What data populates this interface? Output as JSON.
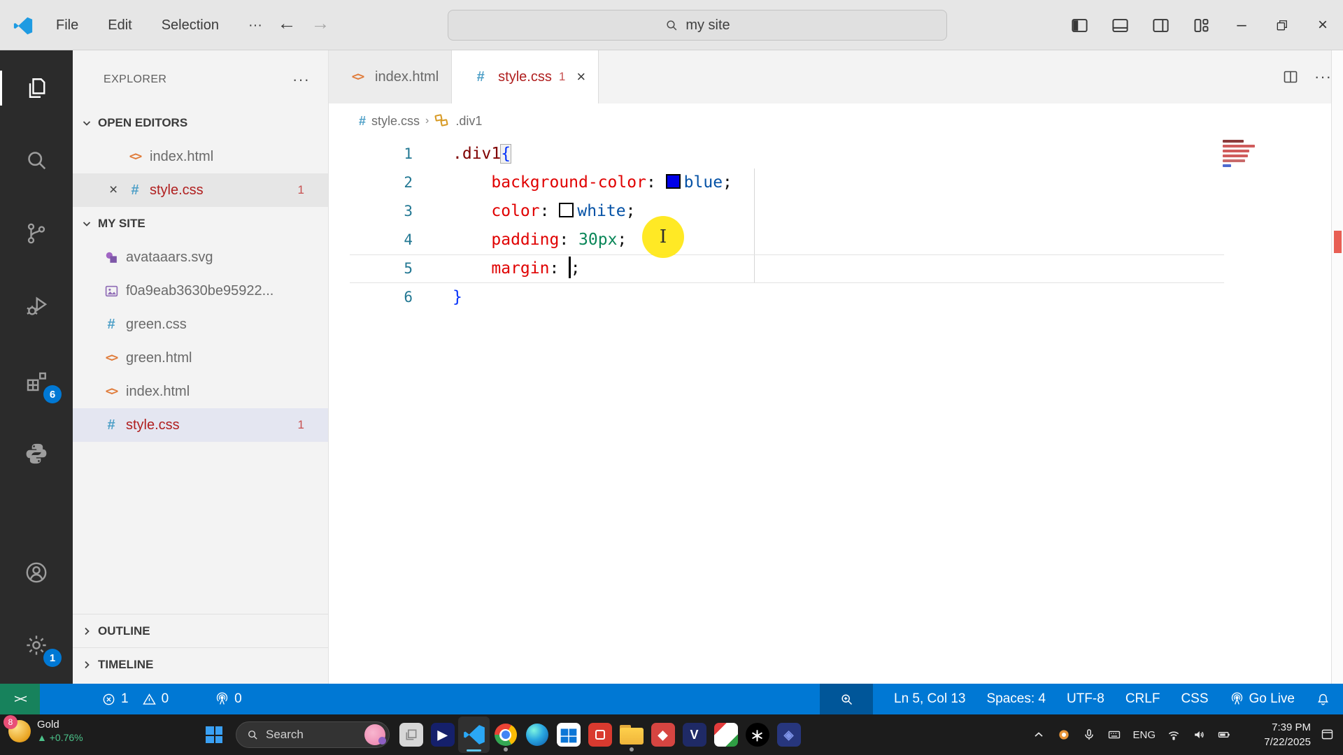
{
  "title_bar": {
    "menus": [
      "File",
      "Edit",
      "Selection",
      "···"
    ],
    "search_value": "my site"
  },
  "icons_glyphs": {
    "back_arrow": "←",
    "forward_arrow": "→",
    "minimize": "–",
    "close": "×",
    "more_dots": "···",
    "html_glyph": "<>",
    "css_glyph": "#",
    "remote_glyph": "><"
  },
  "activity_bar": {
    "items": [
      {
        "name": "explorer",
        "icon": "files",
        "active": true
      },
      {
        "name": "search",
        "icon": "search"
      },
      {
        "name": "source-control",
        "icon": "git"
      },
      {
        "name": "run-debug",
        "icon": "debug"
      },
      {
        "name": "extensions",
        "icon": "extensions",
        "badge": "6"
      },
      {
        "name": "python",
        "icon": "python"
      },
      {
        "name": "accounts",
        "icon": "account"
      },
      {
        "name": "settings",
        "icon": "gear",
        "badge": "1"
      }
    ]
  },
  "explorer": {
    "title": "EXPLORER",
    "actions_label": "···",
    "open_editors_label": "OPEN EDITORS",
    "open_editors": [
      {
        "label": "index.html",
        "icon": "html"
      },
      {
        "label": "style.css",
        "icon": "css",
        "badge": "1",
        "close": true,
        "selected": true,
        "error": true
      }
    ],
    "folder_label": "MY SITE",
    "files": [
      {
        "label": "avataaars.svg",
        "icon": "svg"
      },
      {
        "label": "f0a9eab3630be95922...",
        "icon": "image"
      },
      {
        "label": "green.css",
        "icon": "css"
      },
      {
        "label": "green.html",
        "icon": "html"
      },
      {
        "label": "index.html",
        "icon": "html"
      },
      {
        "label": "style.css",
        "icon": "css",
        "badge": "1",
        "selected": true,
        "error": true
      }
    ],
    "outline_label": "OUTLINE",
    "timeline_label": "TIMELINE"
  },
  "tabs": [
    {
      "label": "index.html",
      "icon": "html"
    },
    {
      "label": "style.css",
      "icon": "css",
      "badge": "1",
      "active": true,
      "error": true
    }
  ],
  "breadcrumb": {
    "file": "style.css",
    "separator": "›",
    "symbol": ".div1"
  },
  "code": {
    "lines": [
      {
        "num": "1",
        "tokens": [
          {
            "text": ".div1",
            "color": "sel"
          },
          {
            "text": "{",
            "color": "brace",
            "box": true
          }
        ]
      },
      {
        "num": "2",
        "tokens": [
          {
            "text": "    ",
            "color": "plain"
          },
          {
            "text": "background-color",
            "color": "prop"
          },
          {
            "text": ": ",
            "color": "plain"
          },
          {
            "swatch": "#0000e8"
          },
          {
            "text": "blue",
            "color": "val"
          },
          {
            "text": ";",
            "color": "plain"
          }
        ]
      },
      {
        "num": "3",
        "tokens": [
          {
            "text": "    ",
            "color": "plain"
          },
          {
            "text": "color",
            "color": "prop"
          },
          {
            "text": ": ",
            "color": "plain"
          },
          {
            "swatch": "#ffffff"
          },
          {
            "text": "white",
            "color": "val"
          },
          {
            "text": ";",
            "color": "plain"
          }
        ]
      },
      {
        "num": "4",
        "tokens": [
          {
            "text": "    ",
            "color": "plain"
          },
          {
            "text": "padding",
            "color": "prop"
          },
          {
            "text": ": ",
            "color": "plain"
          },
          {
            "text": "30px",
            "color": "num"
          },
          {
            "text": ";",
            "color": "plain"
          }
        ]
      },
      {
        "num": "5",
        "current": true,
        "tokens": [
          {
            "text": "    ",
            "color": "plain"
          },
          {
            "text": "margin",
            "color": "prop"
          },
          {
            "text": ": ",
            "color": "plain"
          },
          {
            "caret": true
          },
          {
            "text": ";",
            "color": "plain"
          }
        ]
      },
      {
        "num": "6",
        "tokens": [
          {
            "text": "}",
            "color": "brace"
          }
        ]
      }
    ]
  },
  "status_bar": {
    "remote_label": "><",
    "errors": "1",
    "warnings": "0",
    "ports": "0",
    "line_col": "Ln 5, Col 13",
    "indent": "Spaces: 4",
    "encoding": "UTF-8",
    "eol": "CRLF",
    "language": "CSS",
    "go_live": "Go Live"
  },
  "taskbar": {
    "widget_badge": "8",
    "widget_title": "Gold",
    "widget_change": "▲ +0.76%",
    "search_placeholder": "Search",
    "language": "ENG",
    "time": "7:39 PM",
    "date": "7/22/2025",
    "apps": [
      {
        "name": "photos-app",
        "kind": "photos"
      },
      {
        "name": "media-app",
        "kind": "media"
      },
      {
        "name": "vscode",
        "kind": "vscode",
        "active": true
      },
      {
        "name": "chrome",
        "kind": "chrome",
        "running": true
      },
      {
        "name": "edge",
        "kind": "edge"
      },
      {
        "name": "microsoft-store",
        "kind": "store"
      },
      {
        "name": "red-app",
        "kind": "red"
      },
      {
        "name": "file-explorer",
        "kind": "folder",
        "running": true
      },
      {
        "name": "diamond-app",
        "kind": "diamond"
      },
      {
        "name": "v-app",
        "kind": "v"
      },
      {
        "name": "canva-app",
        "kind": "canva"
      },
      {
        "name": "chatgpt",
        "kind": "chatgpt"
      },
      {
        "name": "blue-app",
        "kind": "blue"
      }
    ]
  },
  "colors": {
    "accent": "#0078d4",
    "remote_green": "#17825c",
    "error_file_red": "#b01f1f",
    "selection_lavender": "#e4e6f1",
    "yellow_highlight": "#ffe81a",
    "activity_bar_bg": "#2b2b2b"
  }
}
